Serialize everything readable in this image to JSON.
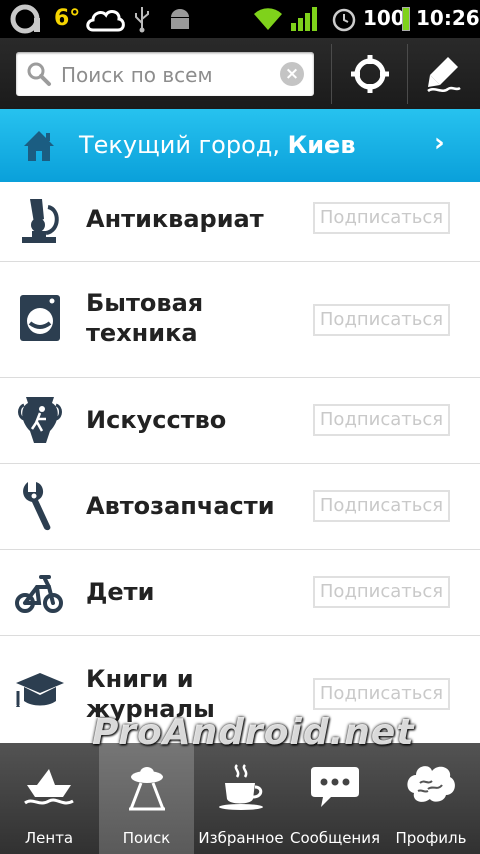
{
  "status_bar": {
    "temperature": "6°",
    "battery": "100",
    "time": "10:26",
    "battery_level": 1.0
  },
  "search": {
    "placeholder": "Поиск по всем"
  },
  "city_banner": {
    "prefix": "Текущий город, ",
    "city": "Киев"
  },
  "categories": [
    {
      "name": "Антиквариат",
      "icon": "microscope-icon",
      "subscribe": "Подписаться"
    },
    {
      "name": "Бытовая техника",
      "icon": "washing-machine-icon",
      "subscribe": "Подписаться"
    },
    {
      "name": "Искусство",
      "icon": "vase-icon",
      "subscribe": "Подписаться"
    },
    {
      "name": "Автозапчасти",
      "icon": "wrench-icon",
      "subscribe": "Подписаться"
    },
    {
      "name": "Дети",
      "icon": "tricycle-icon",
      "subscribe": "Подписаться"
    },
    {
      "name": "Книги и журналы",
      "icon": "graduation-cap-icon",
      "subscribe": "Подписаться"
    }
  ],
  "bottom_nav": [
    {
      "label": "Лента",
      "icon": "paper-boat-icon"
    },
    {
      "label": "Поиск",
      "icon": "ufo-icon",
      "active": true
    },
    {
      "label": "Избранное",
      "icon": "coffee-cup-icon"
    },
    {
      "label": "Сообщения",
      "icon": "speech-bubble-icon"
    },
    {
      "label": "Профиль",
      "icon": "brain-icon"
    }
  ],
  "watermark": "ProAndroid.net",
  "colors": {
    "accent": "#1cb1e6",
    "status_bar": "#000000",
    "nav_bar": "#3f3f3f"
  }
}
